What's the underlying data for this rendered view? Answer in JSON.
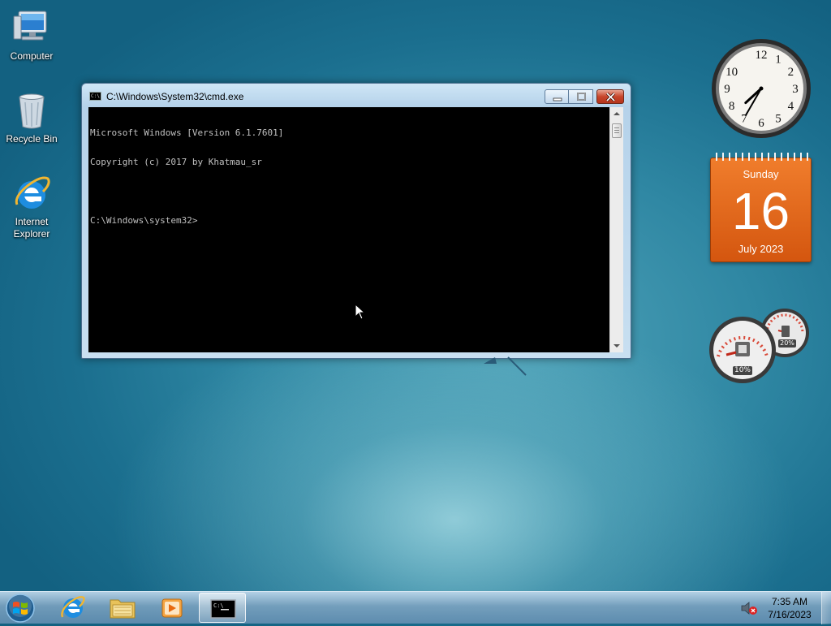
{
  "desktop": {
    "icons": [
      {
        "label": "Computer",
        "icon": "computer-icon"
      },
      {
        "label": "Recycle Bin",
        "icon": "recycle-bin-icon"
      },
      {
        "label": "Internet Explorer",
        "icon": "internet-explorer-icon"
      }
    ]
  },
  "cmd_window": {
    "title": "C:\\Windows\\System32\\cmd.exe",
    "lines": [
      "Microsoft Windows [Version 6.1.7601]",
      "Copyright (c) 2017 by Khatmau_sr",
      "",
      "C:\\Windows\\system32>"
    ],
    "buttons": {
      "minimize": "minimize-icon",
      "maximize": "maximize-icon",
      "close": "close-icon"
    }
  },
  "gadgets": {
    "clock": {
      "numbers": [
        "12",
        "1",
        "2",
        "3",
        "4",
        "5",
        "6",
        "7",
        "8",
        "9",
        "10"
      ],
      "time": "7:35"
    },
    "calendar": {
      "weekday": "Sunday",
      "day": "16",
      "month_year": "July 2023"
    },
    "cpu_meter": {
      "cpu": "10%",
      "memory": "20%"
    }
  },
  "taskbar": {
    "start": "windows-start-icon",
    "pinned": [
      "internet-explorer-icon",
      "folder-icon",
      "media-player-icon",
      "cmd-icon"
    ],
    "active_index": 3,
    "tray": {
      "volume": "muted-speaker-icon",
      "time": "7:35 AM",
      "date": "7/16/2023"
    }
  },
  "colors": {
    "console_bg": "#000000",
    "console_fg": "#c0c0c0",
    "calendar": "#e56a1d"
  }
}
